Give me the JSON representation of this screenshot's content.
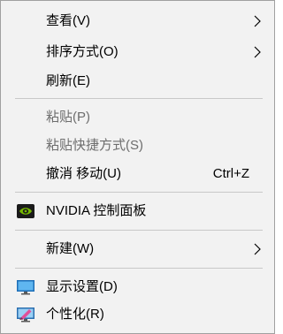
{
  "menu": {
    "items": [
      {
        "label": "查看(V)",
        "has_submenu": true
      },
      {
        "label": "排序方式(O)",
        "has_submenu": true
      },
      {
        "label": "刷新(E)"
      },
      {
        "label": "粘贴(P)",
        "disabled": true
      },
      {
        "label": "粘贴快捷方式(S)",
        "disabled": true
      },
      {
        "label": "撤消 移动(U)",
        "shortcut": "Ctrl+Z"
      },
      {
        "label": "NVIDIA 控制面板",
        "icon": "nvidia-icon"
      },
      {
        "label": "新建(W)",
        "has_submenu": true
      },
      {
        "label": "显示设置(D)",
        "icon": "display-icon"
      },
      {
        "label": "个性化(R)",
        "icon": "personalize-icon"
      }
    ]
  },
  "colors": {
    "background": "#f2f2f2",
    "border": "#a0a0a0",
    "disabled_text": "#6d6d6d",
    "separator": "#c8c8c8",
    "nvidia_green": "#76b900",
    "display_blue": "#2b8fd6"
  }
}
